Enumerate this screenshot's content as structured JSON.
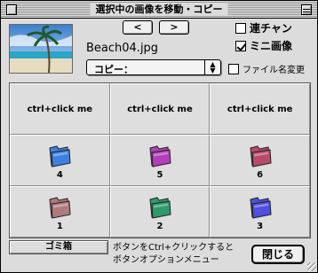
{
  "window": {
    "title": "選択中の画像を移動・コピー"
  },
  "preview": {
    "filename": "Beach04.jpg"
  },
  "nav": {
    "prev_label": "<",
    "next_label": ">"
  },
  "options": {
    "renchan": {
      "label": "連チャン",
      "checked": false
    },
    "mini_image": {
      "label": "ミニ画像",
      "checked": true
    },
    "rename_file": {
      "label": "ファイル名変更",
      "checked": false
    }
  },
  "mode_popup": {
    "selected": "コピー："
  },
  "grid": {
    "cells": [
      {
        "kind": "text",
        "label": "ctrl+click me"
      },
      {
        "kind": "text",
        "label": "ctrl+click me"
      },
      {
        "kind": "text",
        "label": "ctrl+click me"
      },
      {
        "kind": "folder",
        "label": "4",
        "color": "#3f7fe0"
      },
      {
        "kind": "folder",
        "label": "5",
        "color": "#b23fb8"
      },
      {
        "kind": "folder",
        "label": "6",
        "color": "#b84a6a"
      },
      {
        "kind": "folder",
        "label": "1",
        "color": "#b07a7a"
      },
      {
        "kind": "folder",
        "label": "2",
        "color": "#2f9a6a"
      },
      {
        "kind": "folder",
        "label": "3",
        "color": "#4f4fe0"
      }
    ]
  },
  "footer": {
    "trash_label": "ゴミ箱",
    "hint_line1": "ボタンをCtrl+クリックすると",
    "hint_line2": "ボタンオプションメニュー",
    "close_label": "閉じる"
  },
  "icons": {
    "window_close": "close-box-icon",
    "window_collapse": "collapse-box-icon",
    "folder": "folder-icon",
    "popup_arrows": "up-down-arrows-icon"
  }
}
